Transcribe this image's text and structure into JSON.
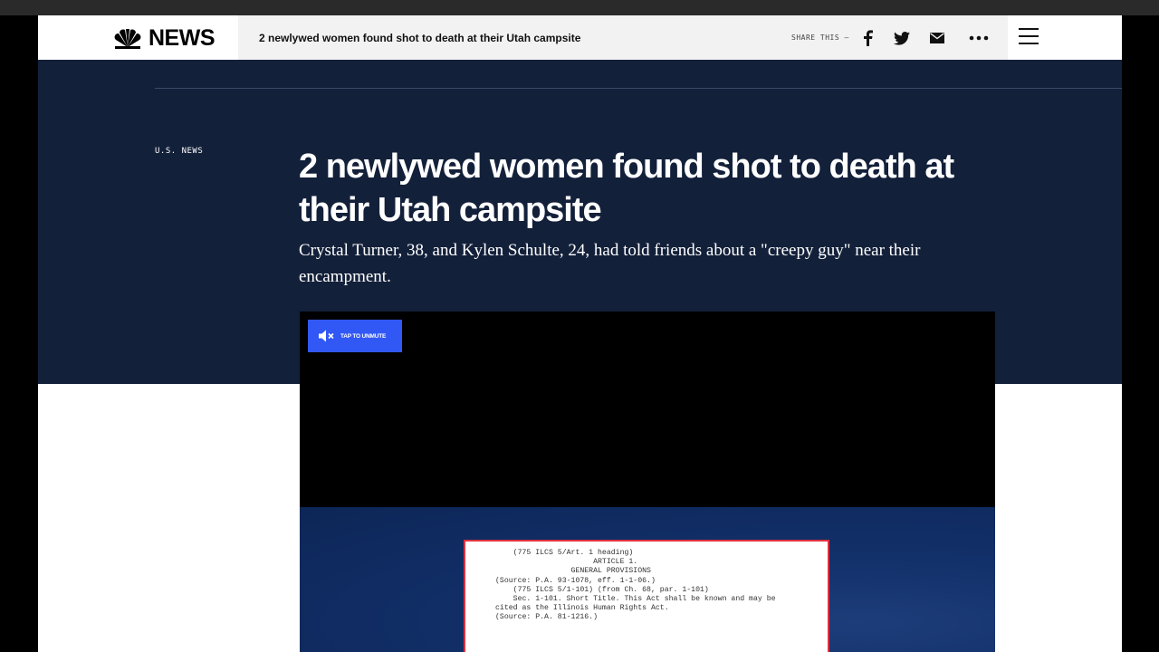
{
  "header": {
    "logo_text": "NEWS",
    "strip_title": "2 newlywed women found shot to death at their Utah campsite",
    "share_label": "SHARE THIS —",
    "share_icons": [
      "facebook-icon",
      "twitter-icon",
      "email-icon",
      "more-icon"
    ],
    "menu_icon": "hamburger-menu-icon"
  },
  "article": {
    "section": "U.S. NEWS",
    "title": "2 newlywed women found shot to death at their Utah campsite",
    "subtitle": "Crystal Turner, 38, and Kylen Schulte, 24, had told friends about a \"creepy guy\" near their encampment."
  },
  "video": {
    "unmute_label": "TAP TO UNMUTE",
    "document_lines": [
      "    (775 ILCS 5/Art. 1 heading)",
      "                      ARTICLE 1.",
      "                 GENERAL PROVISIONS",
      "(Source: P.A. 93-1078, eff. 1-1-06.)",
      "",
      "    (775 ILCS 5/1-101) (from Ch. 68, par. 1-101)",
      "    Sec. 1-101. Short Title. This Act shall be known and may be",
      "cited as the Illinois Human Rights Act.",
      "(Source: P.A. 81-1216.)"
    ]
  },
  "colors": {
    "hero_background": "#13203a",
    "unmute_button": "#3158f5",
    "document_border": "#e0313f"
  }
}
